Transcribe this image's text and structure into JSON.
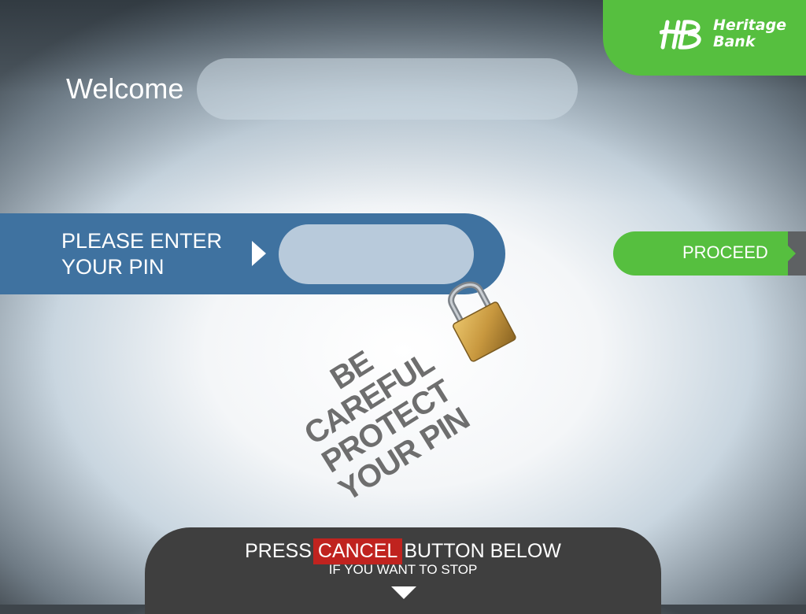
{
  "brand": {
    "name_line1": "Heritage",
    "name_line2": "Bank",
    "logo_icon": "hb-logo-icon",
    "color": "#56bf3f"
  },
  "welcome": {
    "label": "Welcome",
    "value": ""
  },
  "pin": {
    "prompt_line1": "PLEASE ENTER",
    "prompt_line2": "YOUR PIN",
    "value": "",
    "band_color": "#3f72a0"
  },
  "proceed": {
    "label": "PROCEED"
  },
  "warning": {
    "line1": "BE CAREFUL",
    "line2": "PROTECT",
    "line3": "YOUR PIN",
    "icon": "padlock-icon"
  },
  "cancel": {
    "prefix": "PRESS",
    "highlight": "CANCEL",
    "suffix": "BUTTON BELOW",
    "subtext": "IF YOU WANT TO STOP",
    "highlight_color": "#c0231f"
  }
}
